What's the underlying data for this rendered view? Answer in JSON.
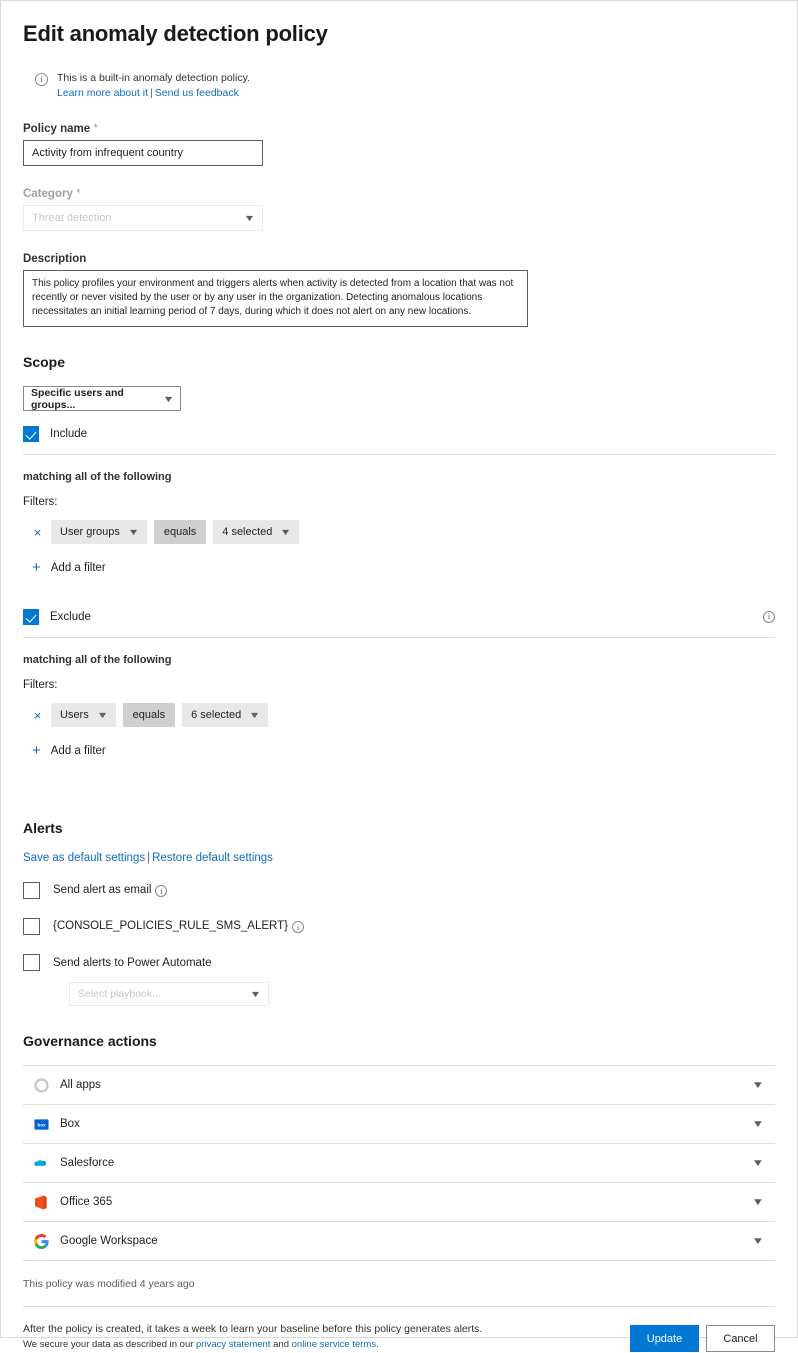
{
  "title": "Edit anomaly detection policy",
  "info_banner": {
    "icon": "info-icon",
    "text": "This is a built-in anomaly detection policy.",
    "link1": "Learn more about it",
    "separator": "|",
    "link2": "Send us feedback"
  },
  "policy_name": {
    "label": "Policy name",
    "required_mark": "*",
    "value": "Activity from infrequent country"
  },
  "category": {
    "label": "Category",
    "required_mark": "*",
    "value": "Threat detection",
    "chevron": "chevron-down-icon"
  },
  "description": {
    "label": "Description",
    "value": "This policy profiles your environment and triggers alerts when activity is detected from a location that was not recently or never visited by the user or by any user in the organization. Detecting anomalous locations necessitates an initial learning period of 7 days, during which it does not alert on any new locations."
  },
  "scope": {
    "heading": "Scope",
    "selector_value": "Specific users and groups...",
    "include": {
      "label": "Include",
      "checked": true,
      "matching_text": "matching all of the following",
      "filters_label": "Filters:",
      "filters": [
        {
          "remove": "×",
          "field": "User groups",
          "operator": "equals",
          "value": "4 selected"
        }
      ],
      "add_filter": "Add a filter"
    },
    "exclude": {
      "label": "Exclude",
      "checked": true,
      "info_icon": "info-icon",
      "matching_text": "matching all of the following",
      "filters_label": "Filters:",
      "filters": [
        {
          "remove": "×",
          "field": "Users",
          "operator": "equals",
          "value": "6 selected"
        }
      ],
      "add_filter": "Add a filter"
    }
  },
  "alerts": {
    "heading": "Alerts",
    "save_default_link": "Save as default settings",
    "separator": "|",
    "restore_default_link": "Restore default settings",
    "options": [
      {
        "label": "Send alert as email",
        "checked": false,
        "has_info": true
      },
      {
        "label": "{CONSOLE_POLICIES_RULE_SMS_ALERT}",
        "checked": false,
        "has_info": true
      },
      {
        "label": "Send alerts to Power Automate",
        "checked": false,
        "has_info": false
      }
    ],
    "playbook_placeholder": "Select playbook..."
  },
  "governance": {
    "heading": "Governance actions",
    "rows": [
      {
        "label": "All apps",
        "icon": "all-apps-icon"
      },
      {
        "label": "Box",
        "icon": "box-icon"
      },
      {
        "label": "Salesforce",
        "icon": "salesforce-icon"
      },
      {
        "label": "Office 365",
        "icon": "office365-icon"
      },
      {
        "label": "Google Workspace",
        "icon": "google-workspace-icon"
      }
    ],
    "chevron": "chevron-down-icon"
  },
  "footer": {
    "modified_note": "This policy was modified 4 years ago",
    "line1": "After the policy is created, it takes a week to learn your baseline before this policy generates alerts.",
    "line2_prefix": "We secure your data as described in our ",
    "privacy_link": "privacy statement",
    "line2_mid": " and ",
    "terms_link": "online service terms",
    "line2_suffix": ".",
    "update_button": "Update",
    "cancel_button": "Cancel"
  },
  "colors": {
    "accent": "#0078d4",
    "link": "#0f6cbd",
    "chip_bg": "#e8e8e8",
    "chip_op_bg": "#cfcfcf",
    "divider": "#e1dfdd"
  }
}
